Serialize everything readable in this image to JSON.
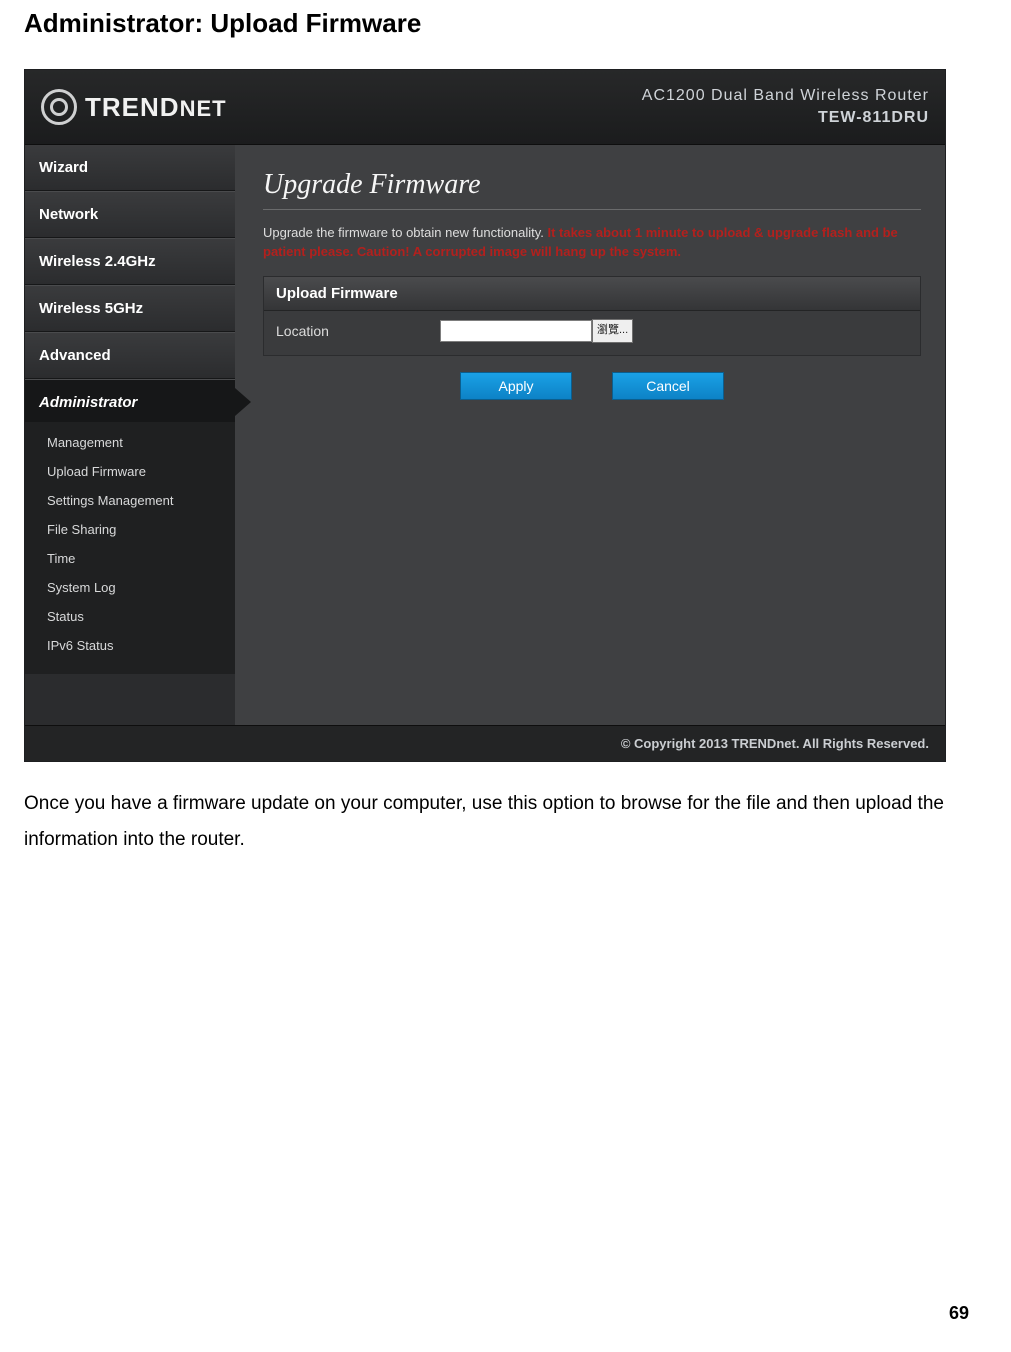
{
  "doc": {
    "heading": "Administrator: Upload Firmware",
    "body_text": "Once you have a firmware update on your computer, use this option to browse for the file and then upload the information into the router.",
    "page_number": "69"
  },
  "header": {
    "brand": "TRENDNET",
    "product_line1": "AC1200 Dual Band Wireless Router",
    "product_line2": "TEW-811DRU"
  },
  "sidebar": {
    "items": [
      "Wizard",
      "Network",
      "Wireless 2.4GHz",
      "Wireless 5GHz",
      "Advanced",
      "Administrator"
    ],
    "subitems": [
      "Management",
      "Upload Firmware",
      "Settings Management",
      "File Sharing",
      "Time",
      "System Log",
      "Status",
      "IPv6 Status"
    ]
  },
  "content": {
    "title": "Upgrade Firmware",
    "desc_plain": "Upgrade the firmware to obtain new functionality. ",
    "desc_warn": "It takes about 1 minute to upload & upgrade flash and be patient please. Caution!  A corrupted image will hang up the system.",
    "panel_title": "Upload Firmware",
    "location_label": "Location",
    "browse_label": "瀏覽...",
    "apply": "Apply",
    "cancel": "Cancel"
  },
  "footer": {
    "copyright": "© Copyright 2013 TRENDnet. All Rights Reserved."
  }
}
